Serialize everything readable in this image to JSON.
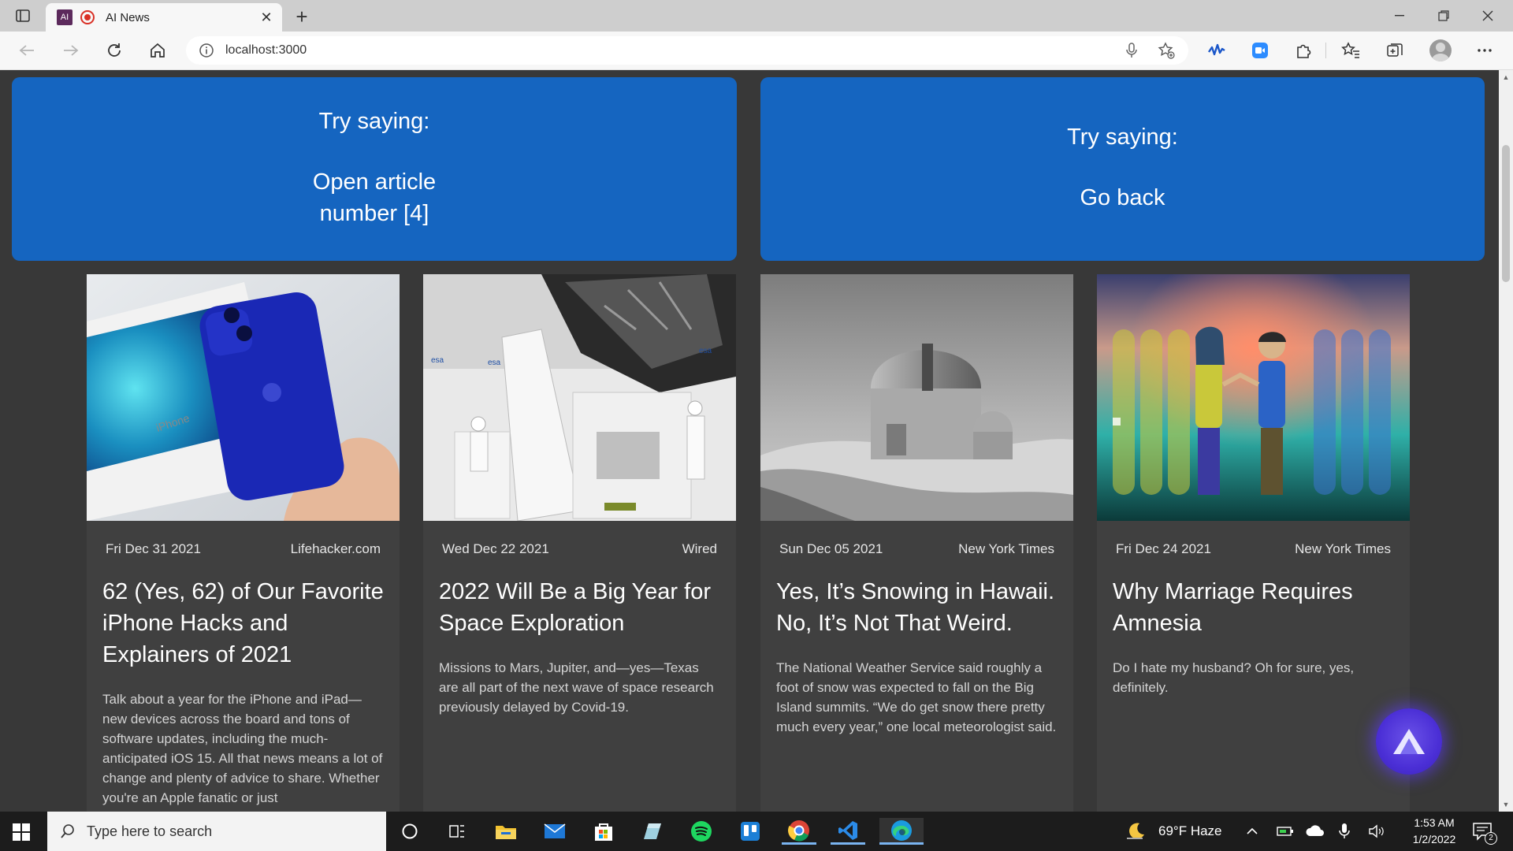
{
  "browser": {
    "tab_title": "AI News",
    "tab_favicon_text": "AI",
    "url": "localhost:3000"
  },
  "info_cards": [
    {
      "heading": "Try saying:",
      "command": "Open article number [4]"
    },
    {
      "heading": "Try saying:",
      "command": "Go back"
    }
  ],
  "articles": [
    {
      "date": "Fri Dec 31 2021",
      "source": "Lifehacker.com",
      "title": "62 (Yes, 62) of Our Favorite iPhone Hacks and Explainers of 2021",
      "description": "Talk about a year for the iPhone and iPad—new devices across the board and tons of software updates, including the much-anticipated iOS 15. All that news means a lot of change and plenty of advice to share. Whether you're an Apple fanatic or just",
      "image": "blue-iphone-photo"
    },
    {
      "date": "Wed Dec 22 2021",
      "source": "Wired",
      "title": "2022 Will Be a Big Year for Space Exploration",
      "description": "Missions to Mars, Jupiter, and—yes—Texas are all part of the next wave of space research previously delayed by Covid-19.",
      "image": "space-lab-photo"
    },
    {
      "date": "Sun Dec 05 2021",
      "source": "New York Times",
      "title": "Yes, It’s Snowing in Hawaii. No, It’s Not That Weird.",
      "description": "The National Weather Service said roughly a foot of snow was expected to fall on the Big Island summits. “We do get snow there pretty much every year,” one local meteorologist said.",
      "image": "observatory-photo"
    },
    {
      "date": "Fri Dec 24 2021",
      "source": "New York Times",
      "title": "Why Marriage Requires Amnesia",
      "description": "Do I hate my husband? Oh for sure, yes, definitely.",
      "image": "couple-illustration"
    }
  ],
  "taskbar": {
    "search_placeholder": "Type here to search",
    "weather": "69°F  Haze",
    "time": "1:53 AM",
    "date": "1/2/2022",
    "notification_count": "2"
  },
  "colors": {
    "page_bg": "#383838",
    "info_card": "#1565c0",
    "news_card": "#404040",
    "alan_button": "#4b2fd6"
  }
}
